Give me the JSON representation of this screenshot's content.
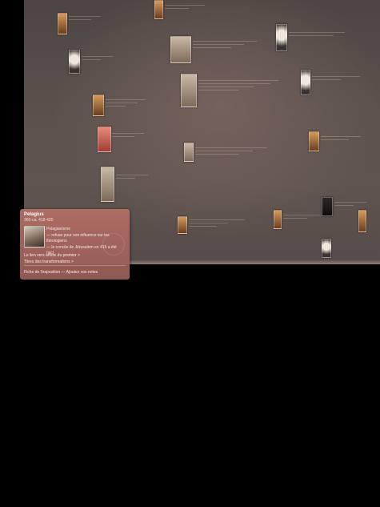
{
  "popup": {
    "title": "Pelagius",
    "dates": "360-ca. 418-420",
    "description": [
      "Pelagianisme",
      "— refuse pour son influence sur les théologiens",
      "— le concile de Jérusalem en 415 a été (sic)"
    ],
    "links": [
      "Le lien vers article du premier >",
      "Titres des transformations >",
      "Fiche de l'exposition — Ajoutez vos notes"
    ]
  },
  "icons": {
    "close": "close-icon"
  }
}
